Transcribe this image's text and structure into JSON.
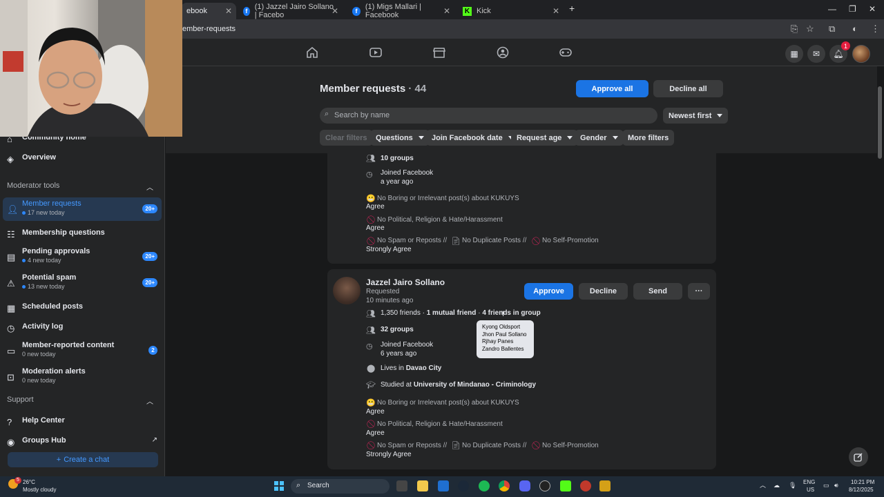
{
  "browser": {
    "tabs": [
      {
        "label": "ebook",
        "active": true
      },
      {
        "label": "(1) Jazzel Jairo Sollano | Facebo",
        "active": false
      },
      {
        "label": "(1) Migs Mallari | Facebook",
        "active": false
      },
      {
        "label": "Kick",
        "active": false
      }
    ],
    "url": "ember-requests"
  },
  "fbnav": {
    "notification_count": "1"
  },
  "sidebar": {
    "items_top": [
      {
        "label": "Community home"
      },
      {
        "label": "Overview"
      }
    ],
    "moderator_tools_title": "Moderator tools",
    "moderator_items": [
      {
        "label": "Member requests",
        "sub": "17 new today",
        "badge": "20+",
        "active": true
      },
      {
        "label": "Membership questions",
        "sub": "",
        "badge": ""
      },
      {
        "label": "Pending approvals",
        "sub": "4 new today",
        "badge": "20+"
      },
      {
        "label": "Potential spam",
        "sub": "13 new today",
        "badge": "20+"
      },
      {
        "label": "Scheduled posts",
        "sub": "",
        "badge": ""
      },
      {
        "label": "Activity log",
        "sub": "",
        "badge": ""
      },
      {
        "label": "Member-reported content",
        "sub": "0 new today",
        "badge": "2"
      },
      {
        "label": "Moderation alerts",
        "sub": "0 new today",
        "badge": ""
      }
    ],
    "support_title": "Support",
    "support_items": [
      {
        "label": "Help Center"
      },
      {
        "label": "Groups Hub"
      }
    ],
    "create_chat": "Create a chat"
  },
  "header": {
    "title": "Member requests",
    "count": "· 44",
    "approve_all": "Approve all",
    "decline_all": "Decline all",
    "search_placeholder": "Search by name",
    "sort": "Newest first",
    "filters": [
      "Clear filters",
      "Questions",
      "Join Facebook date",
      "Request age",
      "Gender",
      "More filters"
    ]
  },
  "card1": {
    "groups": "10 groups",
    "joined_label": "Joined Facebook",
    "joined_value": "a year ago",
    "q1": "No Boring or Irrelevant post(s) about KUKUYS",
    "a1": "Agree",
    "q2": "No Political, Religion & Hate/Harassment",
    "a2": "Agree",
    "q3a": "No Spam or Reposts //",
    "q3b": "No Duplicate Posts //",
    "q3c": "No Self-Promotion",
    "a3": "Strongly Agree"
  },
  "card2": {
    "name": "Jazzel Jairo Sollano",
    "status": "Requested",
    "time": "10 minutes ago",
    "approve": "Approve",
    "decline": "Decline",
    "send": "Send",
    "more": "···",
    "friends": "1,350 friends ·",
    "mutual": "1 mutual friend",
    "in_group_sep": "·",
    "in_group": "4 friends in group",
    "groups": "32 groups",
    "joined_label": "Joined Facebook",
    "joined_value": "6 years ago",
    "lives_prefix": "Lives in",
    "lives": "Davao City",
    "studied_prefix": "Studied at",
    "studied": "University of Mindanao - Criminology",
    "q1": "No Boring or Irrelevant post(s) about KUKUYS",
    "a1": "Agree",
    "q2": "No Political, Religion & Hate/Harassment",
    "a2": "Agree",
    "q3a": "No Spam or Reposts //",
    "q3b": "No Duplicate Posts //",
    "q3c": "No Self-Promotion",
    "a3": "Strongly Agree"
  },
  "tooltip": {
    "names": [
      "Kyong Oldsport",
      "Jhon Paul Sollano",
      "Rjhay Panes",
      "Zandro Ballentes"
    ]
  },
  "taskbar": {
    "weather_temp": "26°C",
    "weather_desc": "Mostly cloudy",
    "weather_badge": "5",
    "search": "Search",
    "lang1": "ENG",
    "lang2": "US",
    "time": "10:21 PM",
    "date": "8/12/2025"
  }
}
